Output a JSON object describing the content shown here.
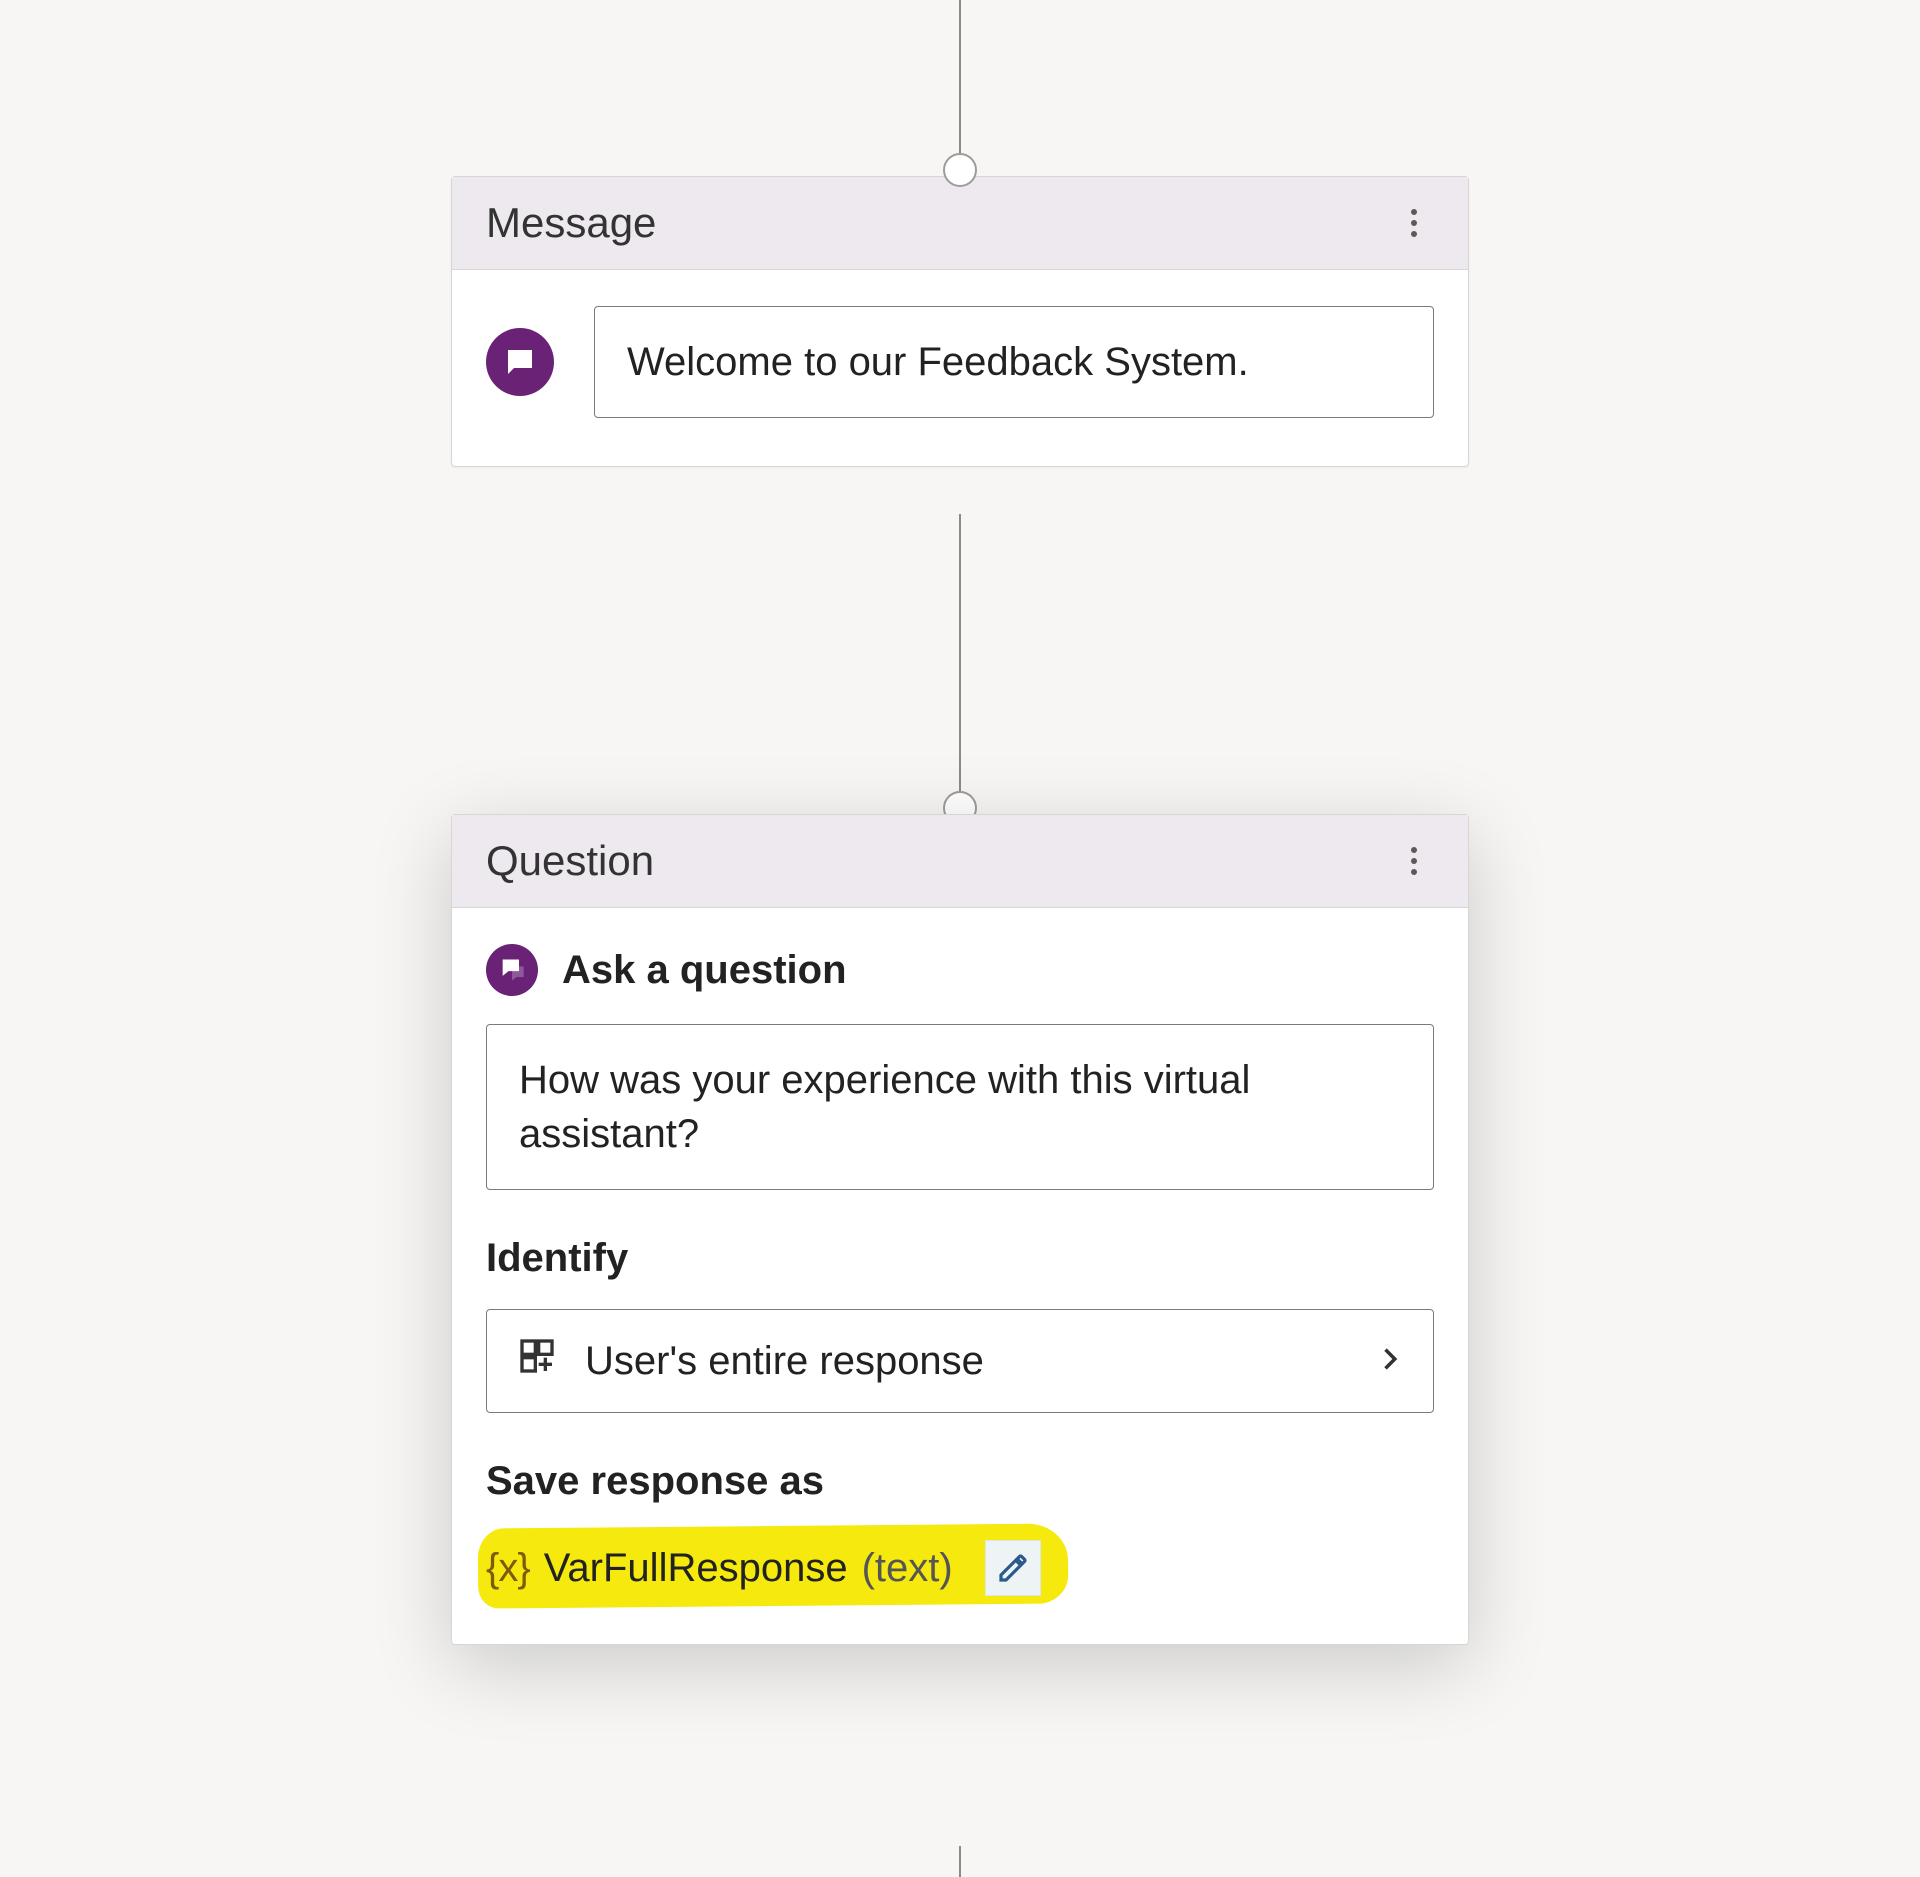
{
  "message_card": {
    "title": "Message",
    "text": "Welcome to our Feedback System.",
    "icon_name": "chat-icon"
  },
  "question_card": {
    "title": "Question",
    "heading": "Ask a question",
    "question_text": "How was your experience with this virtual assistant?",
    "identify_label": "Identify",
    "identify_value": "User's entire response",
    "save_label": "Save response as",
    "variable": {
      "braces": "{x}",
      "name": "VarFullResponse",
      "type": "(text)"
    }
  }
}
